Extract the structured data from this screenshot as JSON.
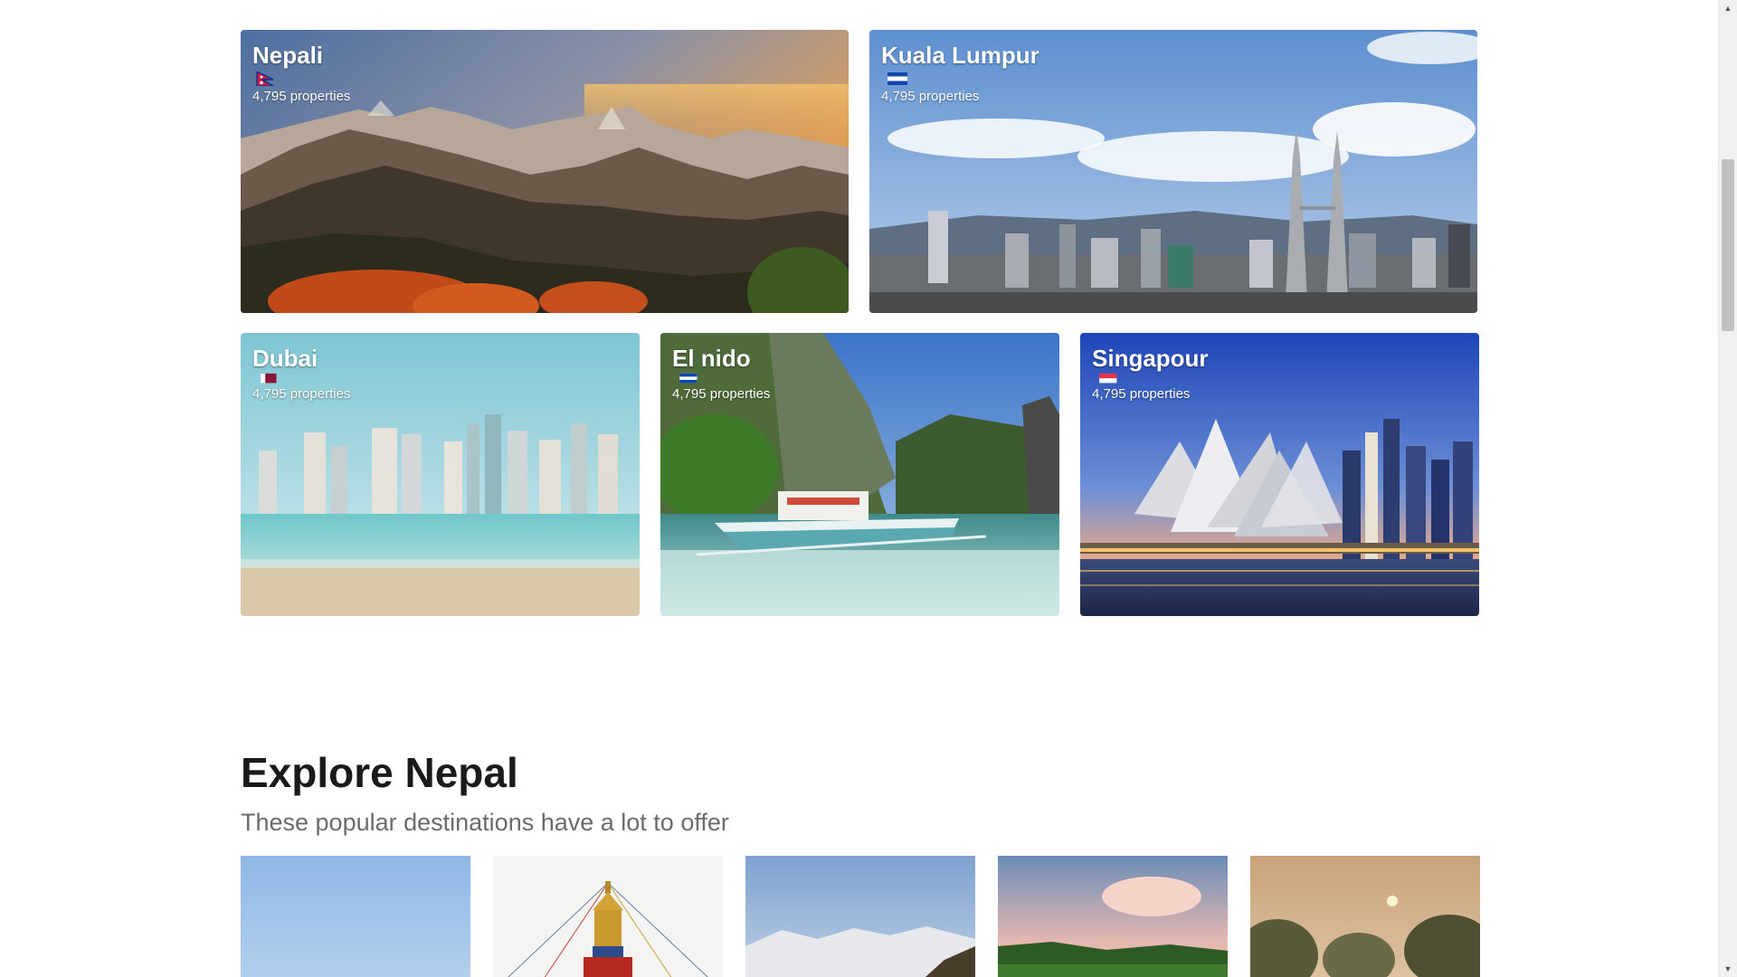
{
  "destinations": [
    {
      "name": "Nepali",
      "flag": "nepal-flag-icon",
      "subtitle": "4,795 properties"
    },
    {
      "name": "Kuala Lumpur",
      "flag": "flag-icon",
      "subtitle": "4,795 properties"
    },
    {
      "name": "Dubai",
      "flag": "qatar-flag-icon",
      "subtitle": "4,795 properties"
    },
    {
      "name": "El nido",
      "flag": "flag-icon",
      "subtitle": "4,795 properties"
    },
    {
      "name": "Singapour",
      "flag": "singapore-flag-icon",
      "subtitle": "4,795 properties"
    }
  ],
  "explore": {
    "title": "Explore Nepal",
    "subtitle": "These popular destinations have a lot to offer"
  },
  "colors": {
    "heading": "#1a1a1a",
    "subheading": "#6b6b6b",
    "card_text": "#ffffff",
    "scrollbar_track": "#f1f1f1",
    "scrollbar_thumb": "#c1c1c1"
  }
}
